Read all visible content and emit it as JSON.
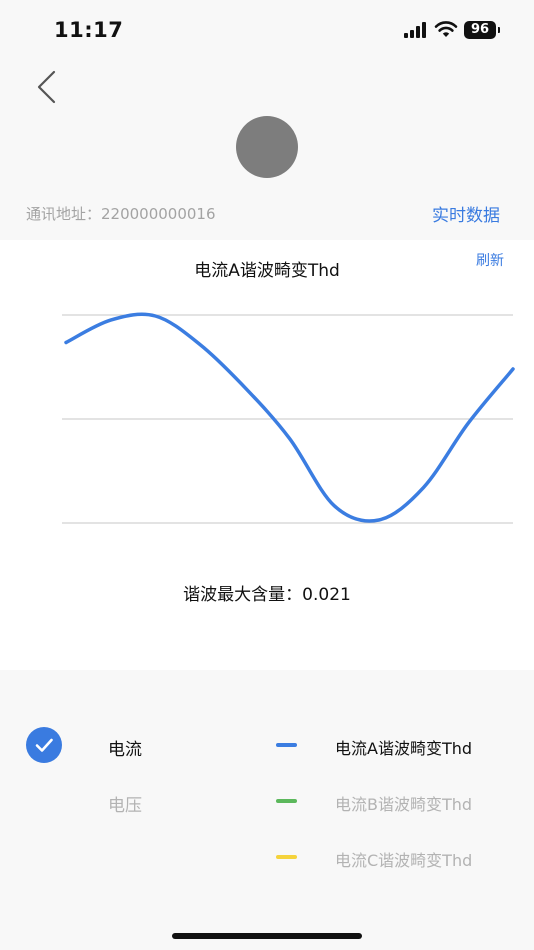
{
  "status_bar": {
    "time": "11:17",
    "battery": "96"
  },
  "header": {
    "address_label": "通讯地址：220000000016",
    "realtime_link": "实时数据"
  },
  "chart_panel": {
    "refresh_label": "刷新",
    "max_content_label": "谐波最大含量：0.021"
  },
  "chart_data": {
    "type": "line",
    "title": "电流A谐波畸变Thd",
    "grid": true,
    "legend": "bottom",
    "series": [
      {
        "name": "电流A谐波畸变Thd",
        "color": "#3b7de1",
        "x": [
          0.0,
          0.1,
          0.2,
          0.3,
          0.4,
          0.5,
          0.6,
          0.7,
          0.8,
          0.9,
          1.0
        ],
        "values": [
          0.74,
          0.96,
          1.0,
          0.72,
          0.3,
          -0.2,
          -0.86,
          -1.0,
          -0.68,
          -0.05,
          0.48
        ]
      }
    ],
    "ylim": [
      -1,
      1
    ]
  },
  "mode_selector": {
    "current": "电流",
    "voltage": "电压"
  },
  "legend": {
    "items": [
      {
        "label": "电流A谐波畸变Thd",
        "color": "#3b7de1",
        "text_color": "#111111"
      },
      {
        "label": "电流B谐波畸变Thd",
        "color": "#5cb85c",
        "text_color": "#b3b3b3"
      },
      {
        "label": "电流C谐波畸变Thd",
        "color": "#f5d33c",
        "text_color": "#b3b3b3"
      }
    ]
  }
}
